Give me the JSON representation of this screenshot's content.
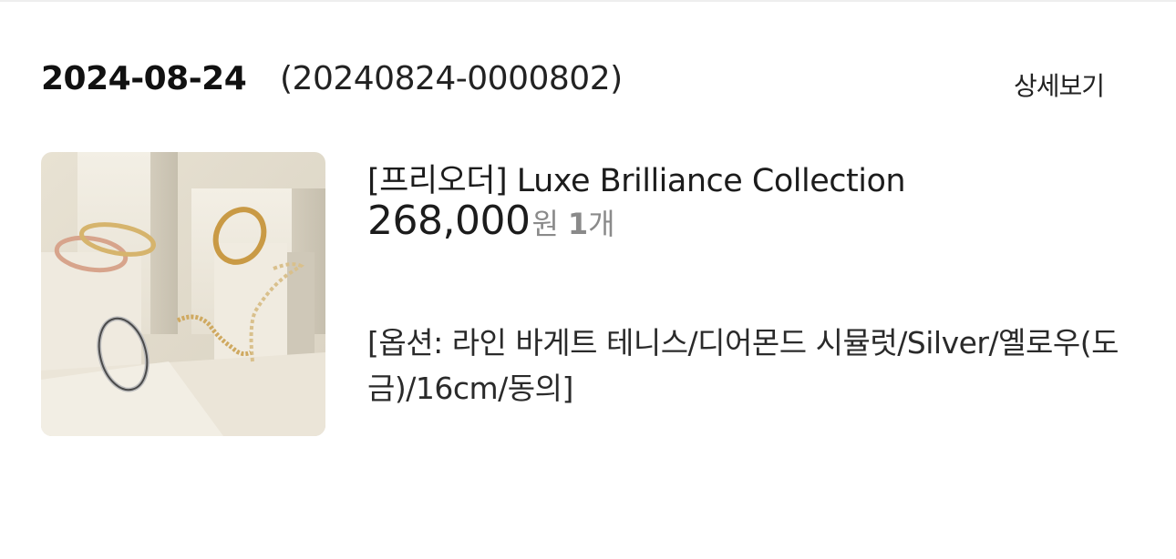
{
  "order": {
    "date": "2024-08-24",
    "number": "(20240824-0000802)",
    "detail_label": "상세보기"
  },
  "product": {
    "name": "[프리오더] Luxe Brilliance Collection",
    "price": "268,000",
    "price_unit": "원",
    "quantity": "1",
    "quantity_unit": "개",
    "options": "[옵션: 라인 바게트 테니스/디어몬드 시뮬럿/Silver/옐로우(도금)/16cm/동의]",
    "thumbnail_icon": "bracelet-product-photo"
  }
}
